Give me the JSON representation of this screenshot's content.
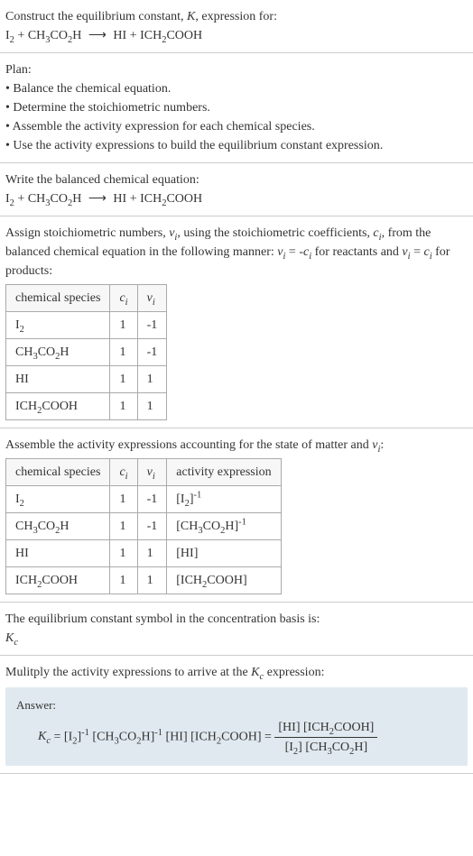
{
  "problem": {
    "title_line1": "Construct the equilibrium constant, K, expression for:",
    "equation": "I₂ + CH₃CO₂H ⟶ HI + ICH₂COOH"
  },
  "plan": {
    "heading": "Plan:",
    "items": [
      "Balance the chemical equation.",
      "Determine the stoichiometric numbers.",
      "Assemble the activity expression for each chemical species.",
      "Use the activity expressions to build the equilibrium constant expression."
    ]
  },
  "balanced": {
    "heading": "Write the balanced chemical equation:",
    "equation": "I₂ + CH₃CO₂H ⟶ HI + ICH₂COOH"
  },
  "stoich": {
    "text_part1": "Assign stoichiometric numbers, ",
    "text_nu": "νᵢ",
    "text_part2": ", using the stoichiometric coefficients, ",
    "text_c": "cᵢ",
    "text_part3": ", from the balanced chemical equation in the following manner: ",
    "text_rel1": "νᵢ = -cᵢ",
    "text_part4": " for reactants and ",
    "text_rel2": "νᵢ = cᵢ",
    "text_part5": " for products:",
    "headers": {
      "species": "chemical species",
      "c": "cᵢ",
      "nu": "νᵢ"
    },
    "rows": [
      {
        "species": "I₂",
        "c": "1",
        "nu": "-1"
      },
      {
        "species": "CH₃CO₂H",
        "c": "1",
        "nu": "-1"
      },
      {
        "species": "HI",
        "c": "1",
        "nu": "1"
      },
      {
        "species": "ICH₂COOH",
        "c": "1",
        "nu": "1"
      }
    ]
  },
  "activity": {
    "heading": "Assemble the activity expressions accounting for the state of matter and νᵢ:",
    "headers": {
      "species": "chemical species",
      "c": "cᵢ",
      "nu": "νᵢ",
      "expr": "activity expression"
    },
    "rows": [
      {
        "species": "I₂",
        "c": "1",
        "nu": "-1",
        "expr": "[I₂]⁻¹"
      },
      {
        "species": "CH₃CO₂H",
        "c": "1",
        "nu": "-1",
        "expr": "[CH₃CO₂H]⁻¹"
      },
      {
        "species": "HI",
        "c": "1",
        "nu": "1",
        "expr": "[HI]"
      },
      {
        "species": "ICH₂COOH",
        "c": "1",
        "nu": "1",
        "expr": "[ICH₂COOH]"
      }
    ]
  },
  "symbol": {
    "heading": "The equilibrium constant symbol in the concentration basis is:",
    "value": "K_c"
  },
  "multiply": {
    "heading": "Mulitply the activity expressions to arrive at the K_c expression:"
  },
  "answer": {
    "label": "Answer:",
    "lhs": "K_c = [I₂]⁻¹ [CH₃CO₂H]⁻¹ [HI] [ICH₂COOH] = ",
    "num": "[HI] [ICH₂COOH]",
    "den": "[I₂] [CH₃CO₂H]"
  }
}
